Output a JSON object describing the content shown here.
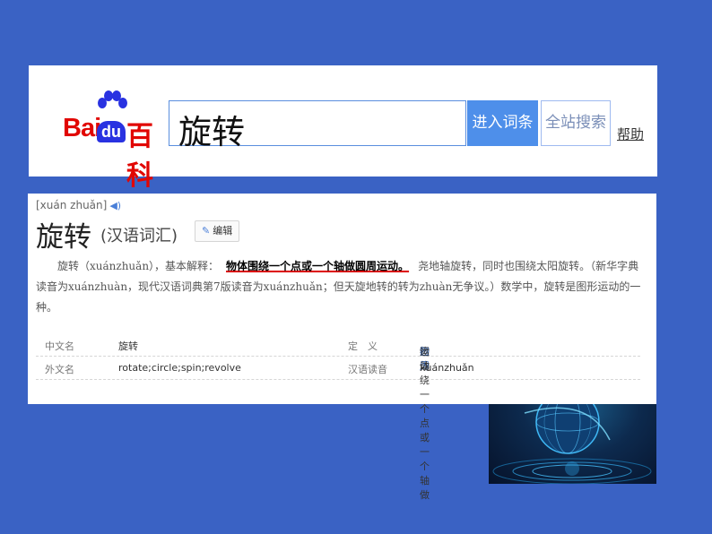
{
  "header": {
    "logo": {
      "bai": "Bai",
      "du": "du",
      "baike": "百科"
    },
    "search": {
      "query": "旋转"
    },
    "enter_button": "进入词条",
    "site_search_button": "全站搜索",
    "help_link": "帮助"
  },
  "entry": {
    "pinyin": "[xuán zhuǎn]",
    "title": "旋转",
    "subtitle": "(汉语词汇)",
    "edit_button": "编辑",
    "paragraph": {
      "part1": "旋转（xuánzhuǎn），基本解释：",
      "highlight": "物体围绕一个点或一个轴做圆周运动。",
      "part2": "尧地轴旋转，同时也围绕太阳旋转。（新华字典读音为xuánzhuàn，现代汉语词典第7版读音为xuánzhuǎn；但天旋地转的转为zhuàn无争议。）数学中，旋转是图形运动的一种。"
    },
    "info_rows": [
      {
        "k1": "中文名",
        "v1": "旋转",
        "k2": "定　义",
        "v2_pre": "物体绕一个点或一个轴做",
        "v2_link": "圆周",
        "v2_post": "运动"
      },
      {
        "k1": "外文名",
        "v1": "rotate;circle;spin;revolve",
        "k2": "汉语读音",
        "v2_pre": "xuánzhuǎn",
        "v2_link": "",
        "v2_post": ""
      }
    ]
  },
  "colors": {
    "background": "#3a62c4",
    "logo_red": "#e10602",
    "logo_blue": "#2932e1",
    "button_blue": "#4e8fea",
    "highlight_underline": "#d00"
  },
  "icons": [
    "baidu-paw-icon",
    "sound-icon",
    "pencil-icon",
    "globe-image"
  ]
}
